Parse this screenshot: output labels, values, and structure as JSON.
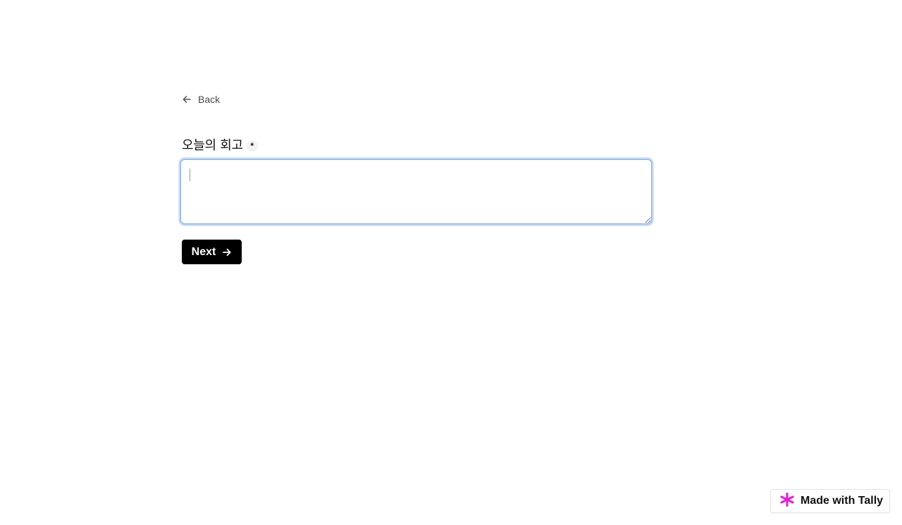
{
  "navigation": {
    "back_label": "Back",
    "back_icon": "arrow-left-icon"
  },
  "question": {
    "title": "오늘의 회고",
    "required_marker": "*",
    "answer_value": ""
  },
  "actions": {
    "next_label": "Next",
    "next_icon": "arrow-right-icon"
  },
  "branding": {
    "label": "Made with Tally",
    "logo_icon": "tally-asterisk-icon",
    "logo_color": "#e11fd6"
  },
  "colors": {
    "focus_ring": "#86b1ea",
    "button_bg": "#000000"
  }
}
